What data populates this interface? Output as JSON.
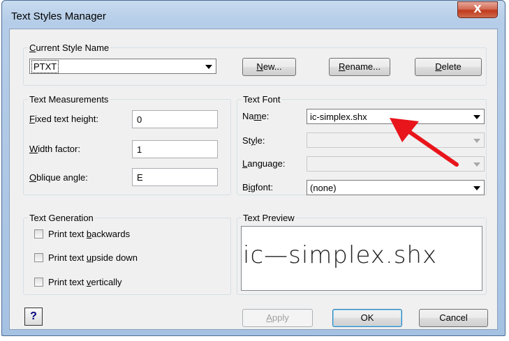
{
  "window": {
    "title": "Text Styles Manager",
    "close_glyph": "X"
  },
  "current_style": {
    "legend_pre": "C",
    "legend_post": "urrent Style Name",
    "selected": "PTXT",
    "new_pre": "N",
    "new_post": "ew...",
    "rename_pre": "R",
    "rename_post": "ename...",
    "delete_pre": "D",
    "delete_post": "elete"
  },
  "measurements": {
    "legend": "Text Measurements",
    "fixed_height_pre": "F",
    "fixed_height_post": "ixed text height:",
    "fixed_height_value": "0",
    "width_factor_pre": "W",
    "width_factor_post": "idth factor:",
    "width_factor_value": "1",
    "oblique_pre": "O",
    "oblique_post": "blique angle:",
    "oblique_value": "E"
  },
  "font": {
    "legend": "Text Font",
    "name_pre": "Na",
    "name_u": "m",
    "name_post": "e:",
    "name_value": "ic-simplex.shx",
    "style_pre": "St",
    "style_u": "y",
    "style_post": "le:",
    "language_pre": "L",
    "language_post": "anguage:",
    "bigfont_pre": "B",
    "bigfont_u": "i",
    "bigfont_post": "gfont:",
    "bigfont_value": "(none)"
  },
  "generation": {
    "legend": "Text Generation",
    "backwards_pre": "Print text ",
    "backwards_u": "b",
    "backwards_post": "ackwards",
    "upside_pre": "Print text ",
    "upside_u": "u",
    "upside_post": "pside down",
    "vertical_pre": "Print text ",
    "vertical_u": "v",
    "vertical_post": "ertically"
  },
  "preview": {
    "legend": "Text Preview",
    "text": "ic—simplex.shx"
  },
  "footer": {
    "help": "?",
    "apply_pre": "A",
    "apply_post": "pply",
    "ok": "OK",
    "cancel": "Cancel"
  },
  "annotation": {
    "arrow_color": "#e8151b"
  }
}
